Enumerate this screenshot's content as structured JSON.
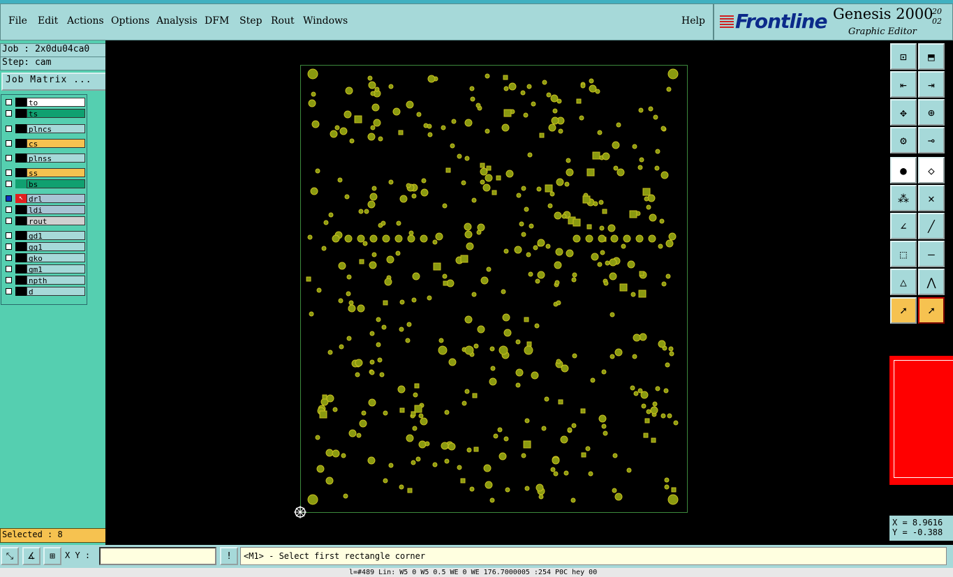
{
  "menu": {
    "items": [
      {
        "label": "File"
      },
      {
        "label": "Edit"
      },
      {
        "label": "Actions"
      },
      {
        "label": "Options"
      },
      {
        "label": "Analysis"
      },
      {
        "label": "DFM"
      },
      {
        "label": "Step"
      },
      {
        "label": "Rout"
      },
      {
        "label": "Windows"
      }
    ],
    "help": "Help"
  },
  "brand": {
    "logo": "Frontline",
    "title": "Genesis 2000",
    "version_top": "20",
    "version_bottom": "02",
    "subtitle": "Graphic Editor"
  },
  "left": {
    "job": "Job : 2x0du04ca0",
    "step": "Step: cam",
    "job_matrix": "Job Matrix ...",
    "selected": "Selected : 8"
  },
  "layers": [
    {
      "name": "to",
      "color": "#ffffff"
    },
    {
      "name": "ts",
      "color": "#10a070"
    },
    {
      "name": "plncs",
      "color": "#a6d9d9"
    },
    {
      "name": "cs",
      "color": "#f6c250"
    },
    {
      "name": "plnss",
      "color": "#a6d9d9"
    },
    {
      "name": "ss",
      "color": "#f6c250"
    },
    {
      "name": "bs",
      "color": "#10a070"
    },
    {
      "name": "drl",
      "color": "#a8c4d4"
    },
    {
      "name": "ldi",
      "color": "#a8c4d4"
    },
    {
      "name": "rout",
      "color": "#d0d0d0"
    },
    {
      "name": "gd1",
      "color": "#a6d9d9"
    },
    {
      "name": "gg1",
      "color": "#a6d9d9"
    },
    {
      "name": "gko",
      "color": "#a6d9d9"
    },
    {
      "name": "gm1",
      "color": "#a6d9d9"
    },
    {
      "name": "npth",
      "color": "#a6d9d9"
    },
    {
      "name": "d",
      "color": "#a6d9d9"
    }
  ],
  "coords": {
    "x": "X = 8.9616",
    "y": "Y = -0.388"
  },
  "bottom": {
    "xy_label": "X Y :",
    "xy_value": "",
    "message": "<M1> - Select first rectangle corner",
    "status": "l=#489 Lin: W5 0 W5 0.5 WE 0 WE 176.7000005 :254 P0C hey 00"
  },
  "colors": {
    "pad": "#8a9a10",
    "pad_center": "#c8c020",
    "board_outline": "#3d8a3d",
    "panel": "#a6d9d9",
    "layer_bg": "#55cfb0"
  }
}
